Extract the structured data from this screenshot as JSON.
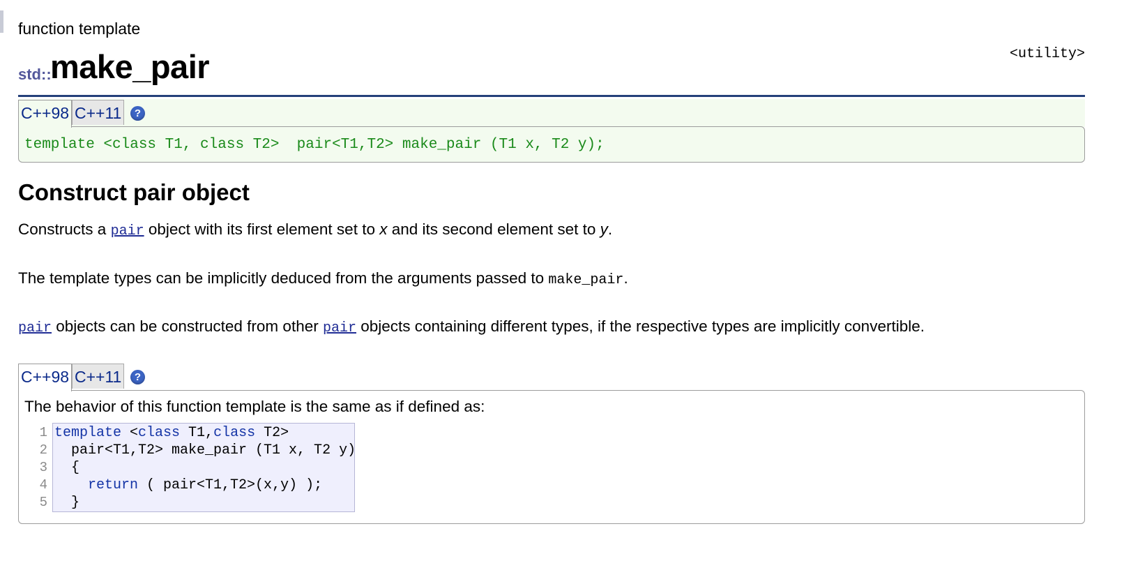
{
  "header": {
    "kind": "function template",
    "namespace": "std::",
    "title": "make_pair",
    "file": "<utility>"
  },
  "prototype": {
    "tabs": [
      "C++98",
      "C++11"
    ],
    "active_tab": "C++98",
    "help_icon": "?",
    "code": "template <class T1, class T2>  pair<T1,T2> make_pair (T1 x, T2 y);"
  },
  "section": {
    "heading": "Construct pair object"
  },
  "description": {
    "p1": {
      "before": "Constructs a ",
      "link": "pair",
      "middle": " object with its first element set to ",
      "var_x": "x",
      "mid2": " and its second element set to ",
      "var_y": "y",
      "after": "."
    },
    "p2": {
      "before": "The template types can be implicitly deduced from the arguments passed to ",
      "code": "make_pair",
      "after": "."
    },
    "p3": {
      "link1": "pair",
      "middle": " objects can be constructed from other ",
      "link2": "pair",
      "after": " objects containing different types, if the respective types are implicitly convertible."
    }
  },
  "behavior": {
    "tabs": [
      "C++98",
      "C++11"
    ],
    "active_tab": "C++98",
    "help_icon": "?",
    "intro": "The behavior of this function template is the same as if defined as:",
    "line_numbers": [
      "1",
      "2",
      "3",
      "4",
      "5"
    ],
    "code_lines": [
      {
        "kw1": "template",
        "t1": " <",
        "kw2": "class",
        "t2": " T1,",
        "kw3": "class",
        "t3": " T2>"
      },
      {
        "text": "  pair<T1,T2> make_pair (T1 x, T2 y)"
      },
      {
        "text": "  {"
      },
      {
        "indent": "    ",
        "kw": "return",
        "rest": " ( pair<T1,T2>(x,y) );"
      },
      {
        "text": "  }"
      }
    ]
  },
  "colors": {
    "header_rule": "#25407a",
    "namespace": "#53579b",
    "link": "#1f2c95",
    "prototype_code": "#1a8a1a",
    "prototype_bg": "#f3fbef",
    "code_bg": "#efeffd",
    "keyword": "#1434a6",
    "help_icon": "#3c64c4"
  }
}
